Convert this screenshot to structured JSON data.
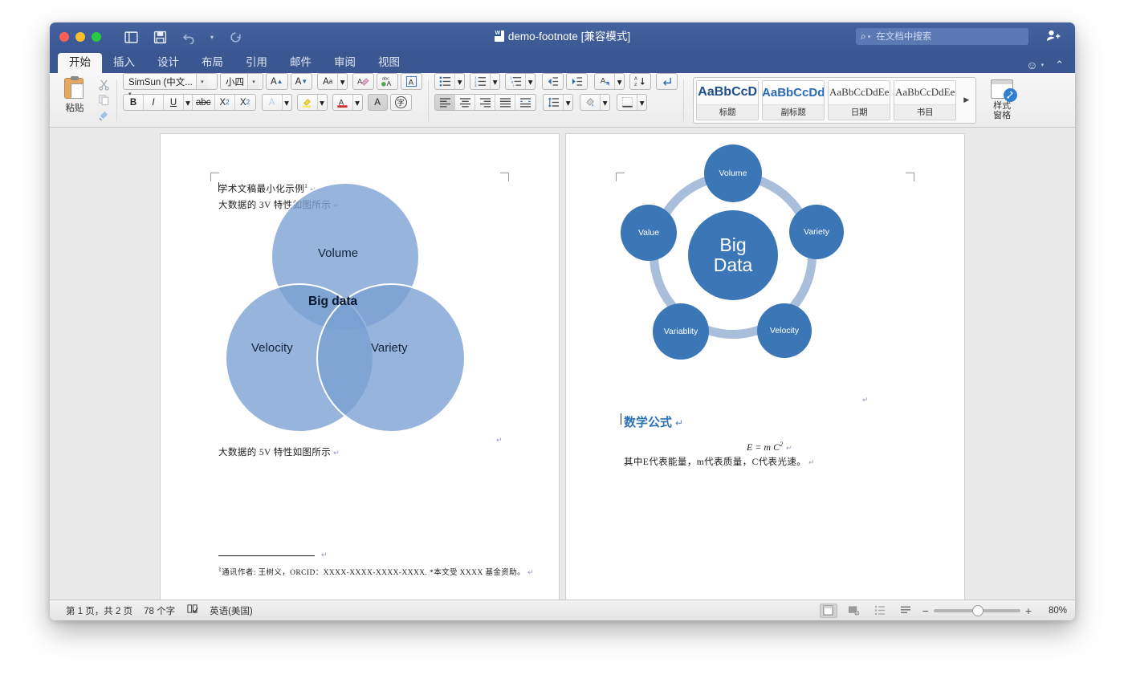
{
  "window": {
    "title": "demo-footnote [兼容模式]",
    "traffic_lights": [
      "close",
      "minimize",
      "maximize"
    ],
    "quick_access": [
      {
        "name": "sidebar-toggle",
        "glyph": "◫"
      },
      {
        "name": "save",
        "glyph": "▤"
      },
      {
        "name": "undo",
        "glyph": "↺"
      },
      {
        "name": "redo",
        "glyph": "↻"
      }
    ]
  },
  "search": {
    "placeholder": "在文档中搜索",
    "value": ""
  },
  "tabs": [
    {
      "label": "开始",
      "active": true
    },
    {
      "label": "插入",
      "active": false
    },
    {
      "label": "设计",
      "active": false
    },
    {
      "label": "布局",
      "active": false
    },
    {
      "label": "引用",
      "active": false
    },
    {
      "label": "邮件",
      "active": false
    },
    {
      "label": "审阅",
      "active": false
    },
    {
      "label": "视图",
      "active": false
    }
  ],
  "ribbon": {
    "paste_label": "粘贴",
    "font_name": "SimSun (中文...",
    "font_size": "小四",
    "styles_pane_label": "样式\n窗格",
    "styles_pane_line1": "样式",
    "styles_pane_line2": "窗格",
    "gallery": [
      {
        "preview": "AaBbCcD",
        "name": "标题"
      },
      {
        "preview": "AaBbCcDd",
        "name": "副标题"
      },
      {
        "preview": "AaBbCcDdEe",
        "name": "日期"
      },
      {
        "preview": "AaBbCcDdEe",
        "name": "书目"
      }
    ],
    "font_buttons": {
      "grow": "A▲",
      "shrink": "A▼",
      "change_case": "Aa",
      "clear_format": "clear-formatting-icon",
      "phonetic": "abc",
      "char_border": "A",
      "bold": "B",
      "italic": "I",
      "underline": "U",
      "strikethrough": "abc",
      "subscript": "X₂",
      "superscript": "X²",
      "text_effects": "A",
      "highlight": "highlight-icon",
      "font_color": "A",
      "char_shading": "A",
      "char_enclose": "字"
    }
  },
  "document": {
    "page1": {
      "line1": "学术文稿最小化示例",
      "line1_footnote_mark": "1",
      "line2": "大数据的 3V 特性如图所示",
      "caption_5v": "大数据的 5V 特性如图所示",
      "footnote": "通讯作者: 王树义，ORCID：XXXX-XXXX-XXXX-XXXX. *本文受 XXXX 基金资助。",
      "footnote_mark": "1",
      "venn": {
        "top": "Volume",
        "left": "Velocity",
        "right": "Variety",
        "center": "Big data"
      }
    },
    "page2": {
      "cycle": {
        "center_line1": "Big",
        "center_line2": "Data",
        "nodes": [
          "Volume",
          "Variety",
          "Velocity",
          "Variablity",
          "Value"
        ]
      },
      "heading": "数学公式",
      "formula": "E = m C",
      "formula_exp": "2",
      "explanation": "其中E代表能量，m代表质量，C代表光速。"
    }
  },
  "status": {
    "page_info": "第 1 页，共 2 页",
    "word_count": "78 个字",
    "proofing_icon": "spellcheck-icon",
    "language": "英语(美国)",
    "zoom_level": "80%",
    "zoom_minus": "−",
    "zoom_plus": "+",
    "views": [
      "print-layout",
      "web-layout",
      "outline",
      "draft"
    ]
  },
  "colors": {
    "ribbon_blue": "#3a5791",
    "titlebar_blue": "#44639f",
    "accent_blue": "#2e74b5",
    "node_blue": "#3b76b6",
    "ring_blue": "#a9bedb",
    "venn_fill": "#7aa0d2"
  }
}
